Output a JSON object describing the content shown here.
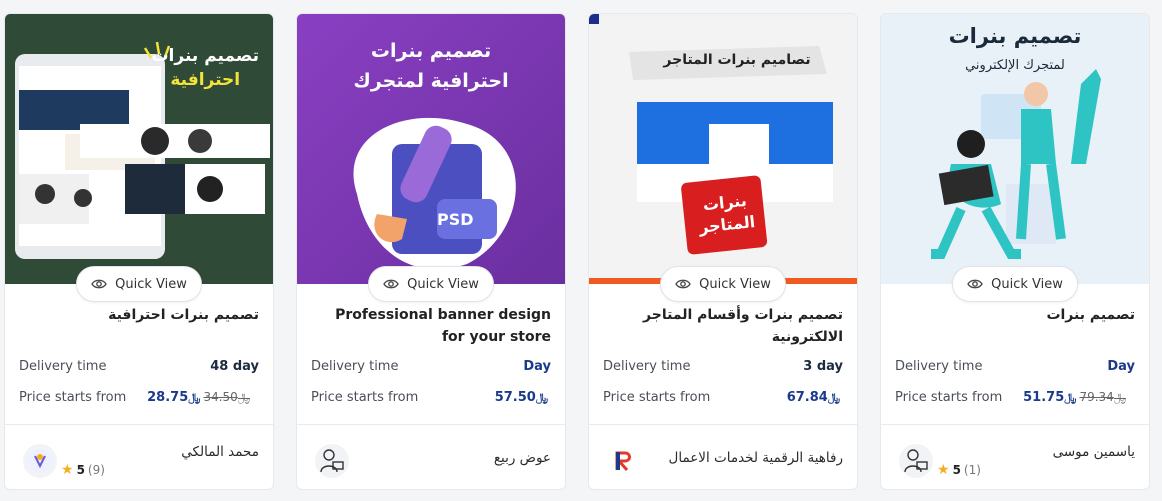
{
  "quick_view_label": "Quick View",
  "delivery_label": "Delivery time",
  "price_label": "Price starts from",
  "currency": "﷼",
  "cards": [
    {
      "thumb_title_1": "تصميم بنرات",
      "thumb_title_2": "احترافية",
      "title": "تصميم بنرات احترافية",
      "delivery": "48 day",
      "old_price": "34.50",
      "price": "28.75",
      "seller": "محمد المالكي",
      "rating": "5",
      "reviews": "(9)"
    },
    {
      "thumb_title_1": "تصميم بنرات",
      "thumb_title_2": "احترافية لمتجرك",
      "thumb_badge": "PSD",
      "title": "Professional banner design for your store",
      "delivery": "Day",
      "price": "57.50",
      "seller": "عوض ربيع"
    },
    {
      "thumb_title_1": "تصاميم بنرات المتاجر",
      "thumb_stamp_1": "بنرات",
      "thumb_stamp_2": "المتاجر",
      "title": "تصميم بنرات وأقسام المتاجر الالكترونية",
      "delivery": "3 day",
      "price": "67.84",
      "seller": "رفاهية الرقمية لخدمات الاعمال"
    },
    {
      "thumb_title_1": "تصميم بنرات",
      "thumb_title_2": "لمتجرك الإلكتروني",
      "title": "تصميم بنرات",
      "delivery": "Day",
      "old_price": "79.34",
      "price": "51.75",
      "seller": "ياسمين موسى",
      "rating": "5",
      "reviews": "(1)"
    }
  ],
  "colors": {
    "price_blue": "#1b3a8c",
    "star": "#f2b01e",
    "card1_bg": "#2f4a36",
    "card2_bg": "#7d3fb0",
    "card3_bg": "#f3f3f3",
    "card4_bg": "#e8f1f7"
  }
}
